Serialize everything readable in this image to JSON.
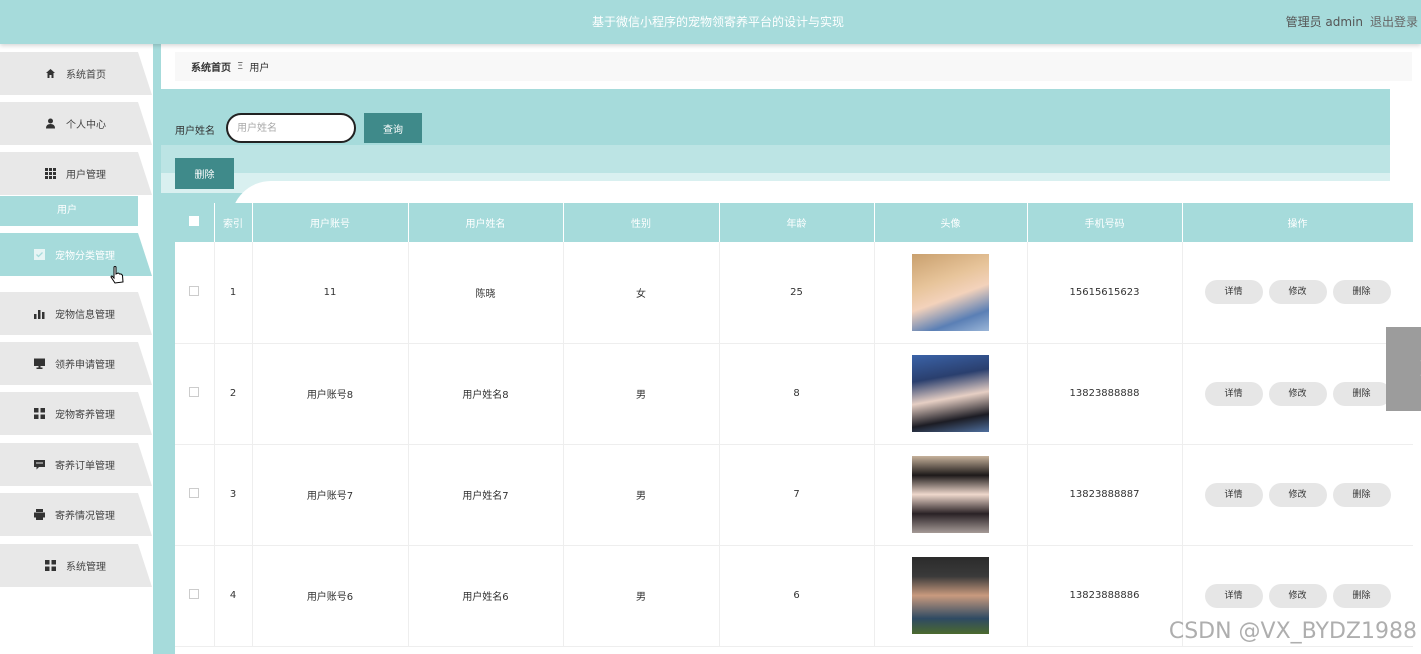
{
  "header": {
    "title": "基于微信小程序的宠物领寄养平台的设计与实现",
    "user_label": "管理员 admin",
    "logout_label": "退出登录",
    "bg_color": "#a6dbdb"
  },
  "sidebar": {
    "items": [
      {
        "label": "系统首页",
        "icon": "home-icon"
      },
      {
        "label": "个人中心",
        "icon": "person-icon"
      },
      {
        "label": "用户管理",
        "icon": "grid-icon"
      },
      {
        "label": "宠物分类管理",
        "icon": "check-square-icon"
      },
      {
        "label": "宠物信息管理",
        "icon": "bar-chart-icon"
      },
      {
        "label": "领养申请管理",
        "icon": "monitor-icon"
      },
      {
        "label": "宠物寄养管理",
        "icon": "apps-icon"
      },
      {
        "label": "寄养订单管理",
        "icon": "message-icon"
      },
      {
        "label": "寄养情况管理",
        "icon": "printer-icon"
      },
      {
        "label": "系统管理",
        "icon": "apps-icon"
      }
    ],
    "sub_item": "用户",
    "active_item": "宠物分类管理"
  },
  "breadcrumb": {
    "home": "系统首页",
    "separator": "Ξ",
    "current": "用户"
  },
  "search": {
    "label": "用户姓名",
    "placeholder": "用户姓名",
    "button": "查询"
  },
  "actions": {
    "delete_label": "删除"
  },
  "table": {
    "columns": [
      "索引",
      "用户账号",
      "用户姓名",
      "性别",
      "年龄",
      "头像",
      "手机号码",
      "操作"
    ],
    "rows": [
      {
        "index": "1",
        "account": "11",
        "name": "陈晓",
        "gender": "女",
        "age": "25",
        "phone": "15615615623"
      },
      {
        "index": "2",
        "account": "用户账号8",
        "name": "用户姓名8",
        "gender": "男",
        "age": "8",
        "phone": "13823888888"
      },
      {
        "index": "3",
        "account": "用户账号7",
        "name": "用户姓名7",
        "gender": "男",
        "age": "7",
        "phone": "13823888887"
      },
      {
        "index": "4",
        "account": "用户账号6",
        "name": "用户姓名6",
        "gender": "男",
        "age": "6",
        "phone": "13823888886"
      }
    ],
    "ops": {
      "detail": "详情",
      "edit": "修改",
      "delete": "删除"
    }
  },
  "watermark": "CSDN @VX_BYDZ1988"
}
